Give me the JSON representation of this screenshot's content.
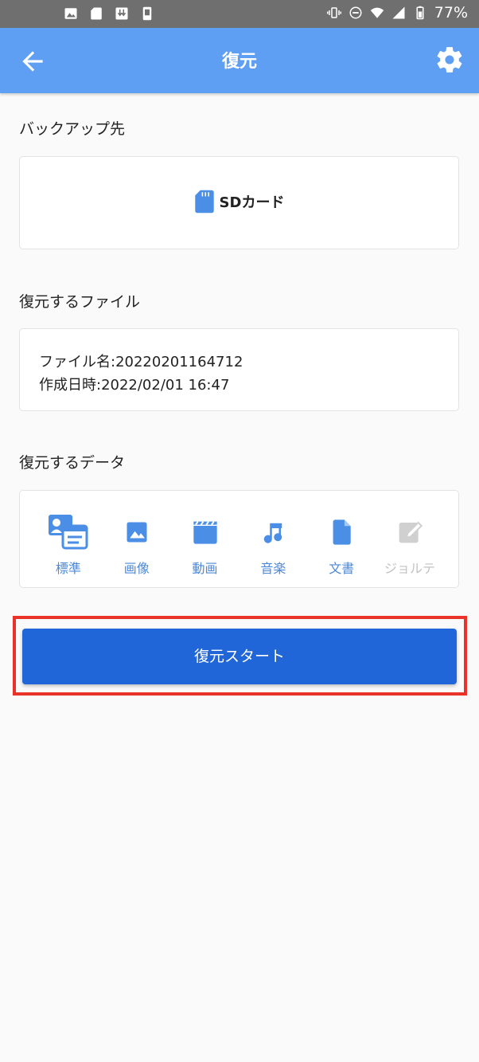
{
  "status_bar": {
    "battery_text": "77%",
    "left_icons": [
      "image-icon",
      "sd-card-icon",
      "download-icon",
      "phone-icon"
    ],
    "right_icons": [
      "vibrate-icon",
      "do-not-disturb-icon",
      "wifi-icon",
      "signal-icon",
      "battery-icon"
    ]
  },
  "app_bar": {
    "title": "復元",
    "back_icon": "arrow-left-icon",
    "settings_icon": "gear-icon",
    "color": "#5e9ef3"
  },
  "backup_destination": {
    "label": "バックアップ先",
    "value": "SDカード",
    "icon": "sd-card-icon"
  },
  "restore_file": {
    "label": "復元するファイル",
    "name_line": "ファイル名:20220201164712",
    "date_line": "作成日時:2022/02/01 16:47"
  },
  "restore_data": {
    "label": "復元するデータ",
    "items": [
      {
        "label": "標準",
        "icon": "contacts-calendar-icon",
        "enabled": true
      },
      {
        "label": "画像",
        "icon": "image-icon",
        "enabled": true
      },
      {
        "label": "動画",
        "icon": "movie-icon",
        "enabled": true
      },
      {
        "label": "音楽",
        "icon": "music-note-icon",
        "enabled": true
      },
      {
        "label": "文書",
        "icon": "document-icon",
        "enabled": true
      },
      {
        "label": "ジョルテ",
        "icon": "edit-note-icon",
        "enabled": false
      }
    ]
  },
  "start_button": {
    "label": "復元スタート",
    "color": "#2066d8",
    "highlight_color": "#e8322a"
  }
}
